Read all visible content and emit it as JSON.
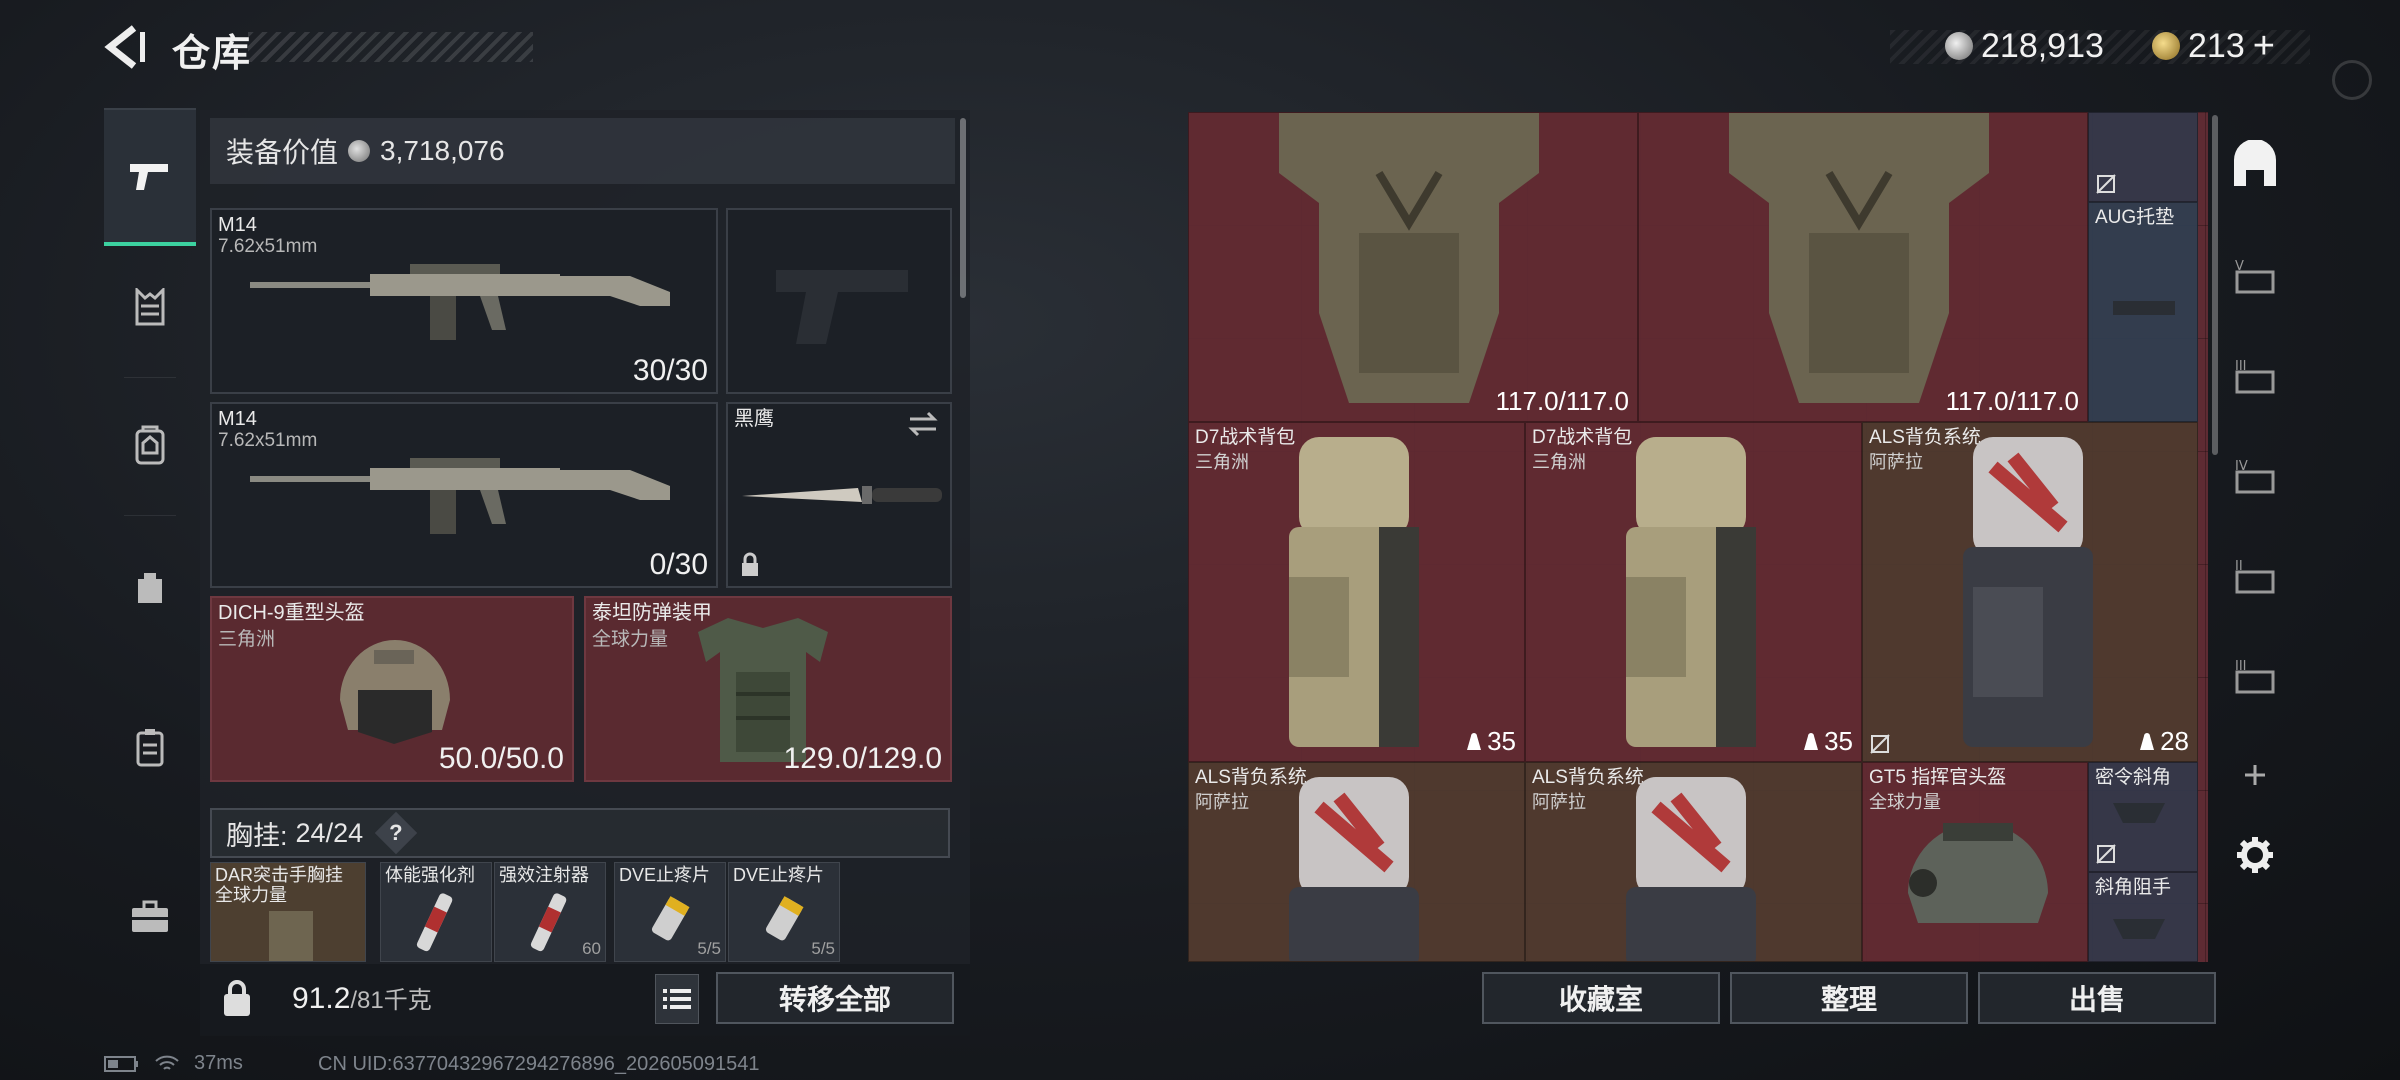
{
  "header": {
    "title": "仓库",
    "silver_amount": "218,913",
    "gold_amount": "213",
    "add_label": "+"
  },
  "left": {
    "value_label": "装备价值",
    "value_amount": "3,718,076",
    "primary_weapon": {
      "name": "M14",
      "caliber": "7.62x51mm",
      "ammo": "30/30"
    },
    "secondary_weapon": {
      "name": "M14",
      "caliber": "7.62x51mm",
      "ammo": "0/30"
    },
    "melee": {
      "name": "黑鹰"
    },
    "helmet": {
      "name": "DICH-9重型头盔",
      "faction": "三角洲",
      "durability": "50.0/50.0"
    },
    "armor": {
      "name": "泰坦防弹装甲",
      "faction": "全球力量",
      "durability": "129.0/129.0"
    },
    "chest_rig": {
      "label": "胸挂:",
      "used": "24",
      "total": "/24",
      "help": "?"
    },
    "chest_items": [
      {
        "name": "DAR突击手胸挂",
        "sub": "全球力量"
      },
      {
        "name": "体能强化剂",
        "foot": ""
      },
      {
        "name": "强效注射器",
        "foot": "60"
      },
      {
        "name": "DVE止疼片",
        "foot": "5/5"
      },
      {
        "name": "DVE止疼片",
        "foot": "5/5"
      }
    ],
    "weight_value": "91.2",
    "weight_limit": "/81千克",
    "transfer_all": "转移全部"
  },
  "grid": {
    "armor_top_1": "117.0/117.0",
    "armor_top_2": "117.0/117.0",
    "aug_label": "AUG托垫",
    "backpacks": [
      {
        "name": "D7战术背包",
        "sub": "三角洲",
        "count": "35"
      },
      {
        "name": "D7战术背包",
        "sub": "三角洲",
        "count": "35"
      },
      {
        "name": "ALS背负系统",
        "sub": "阿萨拉",
        "count": "28"
      },
      {
        "name": "ALS背负系统",
        "sub": "阿萨拉"
      },
      {
        "name": "ALS背负系统",
        "sub": "阿萨拉"
      }
    ],
    "helmet": {
      "name": "GT5 指挥官头盔",
      "sub": "全球力量"
    },
    "small_1": "密令斜角",
    "small_2": "斜角阻手"
  },
  "bottom_buttons": {
    "collection": "收藏室",
    "sort": "整理",
    "sell": "出售"
  },
  "status": {
    "ping": "37ms",
    "uid": "CN UID:63770432967294276896_202605091541"
  },
  "colors": {
    "accent": "#3cd2a0",
    "slot_red": "#5a2a30",
    "grid_maroon": "#602a32"
  }
}
